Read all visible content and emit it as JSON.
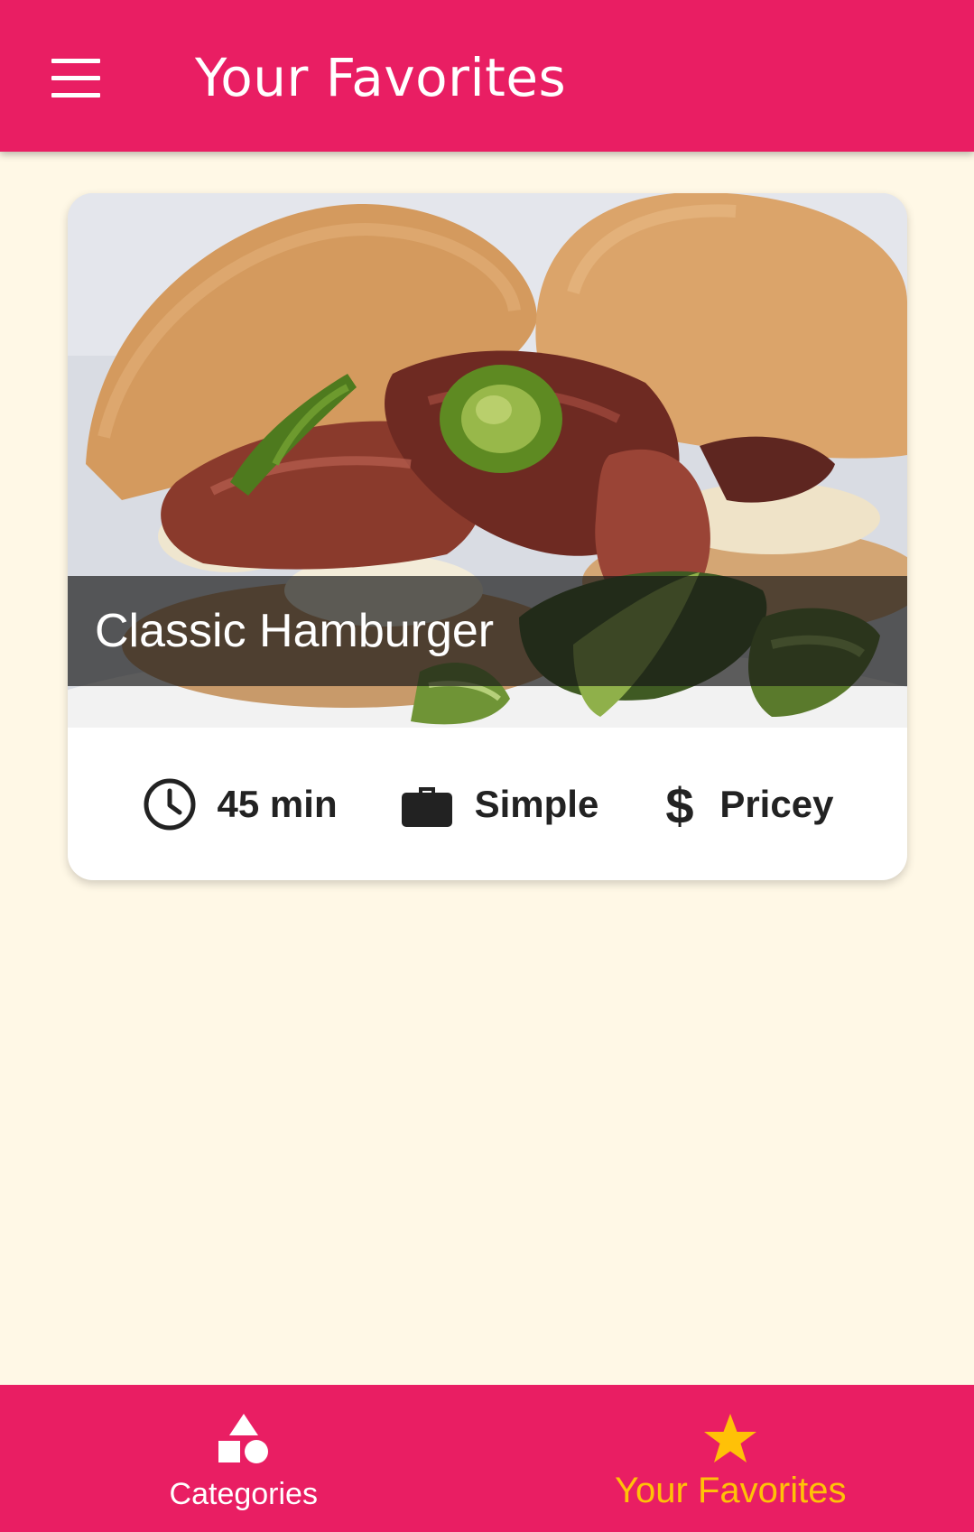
{
  "app_bar": {
    "title": "Your Favorites",
    "menu_icon": "menu-icon",
    "background_color": "#E91E63"
  },
  "favorites": [
    {
      "title": "Classic Hamburger",
      "image": "hamburger-photo",
      "duration": "45 min",
      "complexity": "Simple",
      "affordability": "Pricey"
    }
  ],
  "bottom_nav": {
    "items": [
      {
        "label": "Categories",
        "icon": "category-shapes-icon",
        "active": false
      },
      {
        "label": "Your Favorites",
        "icon": "star-icon",
        "active": true
      }
    ],
    "active_color": "#FFC107"
  },
  "colors": {
    "primary": "#E91E63",
    "background": "#FFF8E6",
    "accent": "#FFC107"
  }
}
